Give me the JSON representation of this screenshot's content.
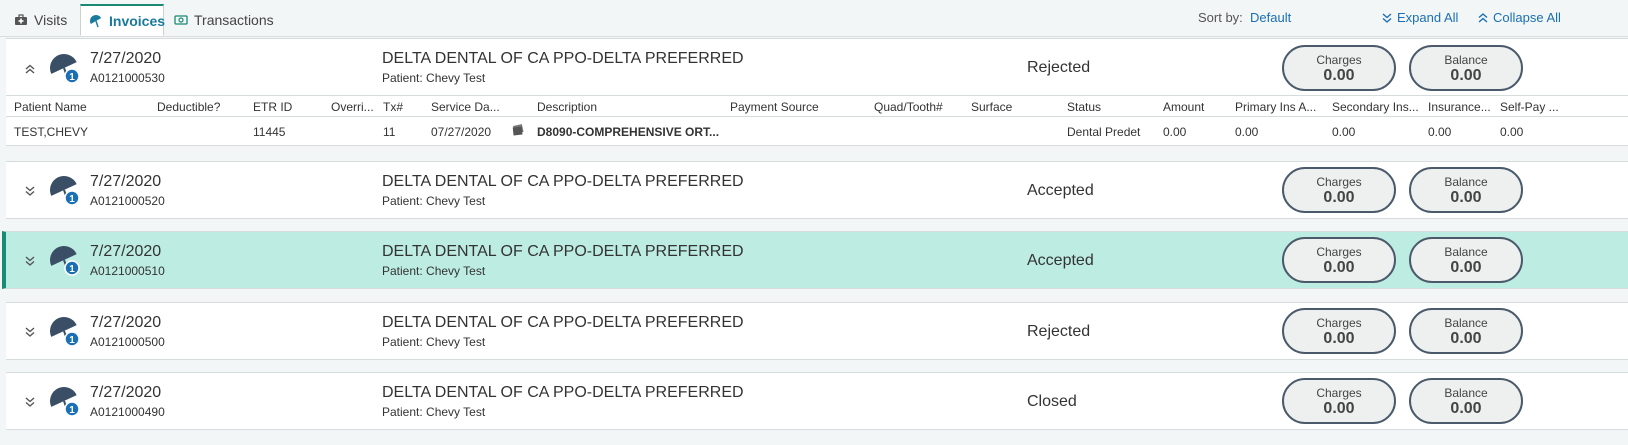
{
  "tabs": [
    {
      "label": "Visits",
      "icon": "medical-bag-icon",
      "active": false
    },
    {
      "label": "Invoices",
      "icon": "umbrella-icon",
      "active": true
    },
    {
      "label": "Transactions",
      "icon": "cash-icon",
      "active": false
    }
  ],
  "sort": {
    "label": "Sort by:",
    "value": "Default"
  },
  "expand_all": "Expand All",
  "collapse_all": "Collapse All",
  "colors": {
    "accent": "#1a8a74",
    "selected_row": "#bdece2",
    "link": "#1a6fb5"
  },
  "detail_columns": [
    "Patient Name",
    "Deductible?",
    "ETR ID",
    "Overri...",
    "Tx#",
    "Service Da...",
    "",
    "Description",
    "Payment Source",
    "Quad/Tooth#",
    "Surface",
    "Status",
    "Amount",
    "Primary Ins A...",
    "Secondary Ins...",
    "Insurance...",
    "Self-Pay ..."
  ],
  "detail_row": [
    "TEST,CHEVY",
    "",
    "11445",
    "",
    "11",
    "07/27/2020",
    "",
    "D8090-COMPREHENSIVE ORT...",
    "",
    "",
    "",
    "Dental Predet",
    "0.00",
    "0.00",
    "0.00",
    "0.00",
    "0.00"
  ],
  "invoices": [
    {
      "date": "7/27/2020",
      "invoice_no": "A0121000530",
      "payer": "DELTA DENTAL OF CA PPO-DELTA PREFERRED",
      "patient": "Patient: Chevy Test",
      "status": "Rejected",
      "charges_label": "Charges",
      "charges": "0.00",
      "balance_label": "Balance",
      "balance": "0.00",
      "badge": "1",
      "expanded": true,
      "selected": false
    },
    {
      "date": "7/27/2020",
      "invoice_no": "A0121000520",
      "payer": "DELTA DENTAL OF CA PPO-DELTA PREFERRED",
      "patient": "Patient: Chevy Test",
      "status": "Accepted",
      "charges_label": "Charges",
      "charges": "0.00",
      "balance_label": "Balance",
      "balance": "0.00",
      "badge": "1",
      "expanded": false,
      "selected": false
    },
    {
      "date": "7/27/2020",
      "invoice_no": "A0121000510",
      "payer": "DELTA DENTAL OF CA PPO-DELTA PREFERRED",
      "patient": "Patient: Chevy Test",
      "status": "Accepted",
      "charges_label": "Charges",
      "charges": "0.00",
      "balance_label": "Balance",
      "balance": "0.00",
      "badge": "1",
      "expanded": false,
      "selected": true
    },
    {
      "date": "7/27/2020",
      "invoice_no": "A0121000500",
      "payer": "DELTA DENTAL OF CA PPO-DELTA PREFERRED",
      "patient": "Patient: Chevy Test",
      "status": "Rejected",
      "charges_label": "Charges",
      "charges": "0.00",
      "balance_label": "Balance",
      "balance": "0.00",
      "badge": "1",
      "expanded": false,
      "selected": false
    },
    {
      "date": "7/27/2020",
      "invoice_no": "A0121000490",
      "payer": "DELTA DENTAL OF CA PPO-DELTA PREFERRED",
      "patient": "Patient: Chevy Test",
      "status": "Closed",
      "charges_label": "Charges",
      "charges": "0.00",
      "balance_label": "Balance",
      "balance": "0.00",
      "badge": "1",
      "expanded": false,
      "selected": false
    }
  ]
}
